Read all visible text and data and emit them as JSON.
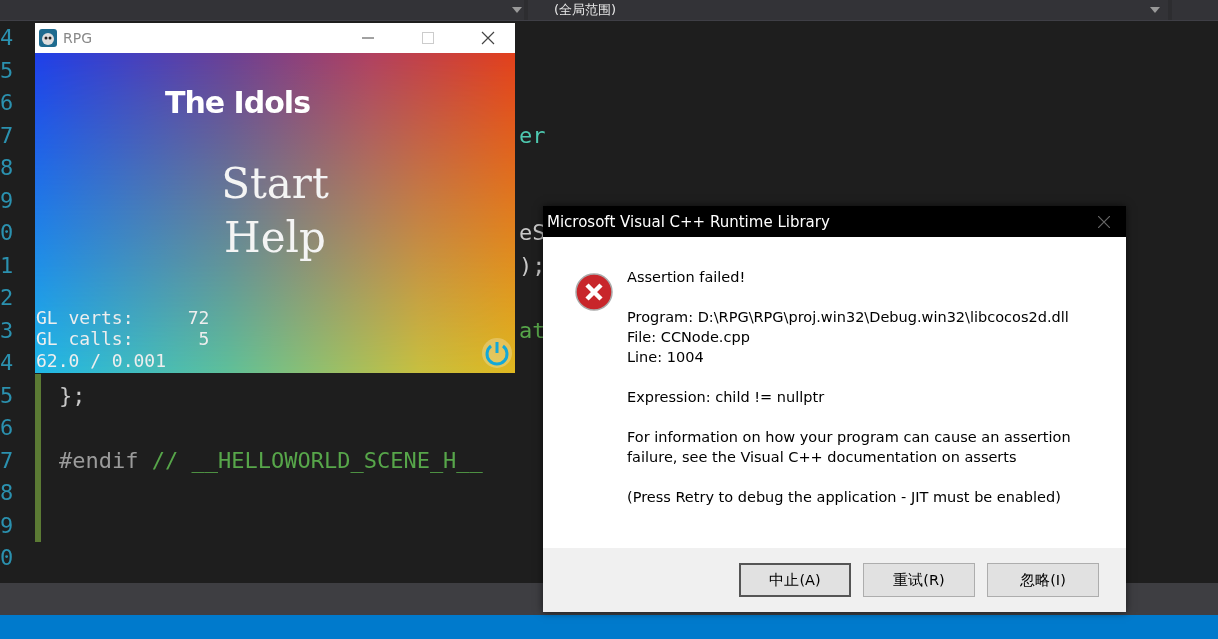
{
  "toolbar": {
    "scope_dropdown": "(全局范围)"
  },
  "editor": {
    "lines": [
      {
        "number": "4"
      },
      {
        "number": "5"
      },
      {
        "number": "6"
      },
      {
        "number": "7",
        "segments": [
          {
            "text": "er",
            "kind": "type"
          }
        ],
        "behind_window": true
      },
      {
        "number": "8"
      },
      {
        "number": "9"
      },
      {
        "number": "0",
        "segments": [
          {
            "text": "eS",
            "kind": "plain"
          }
        ],
        "behind_window": true
      },
      {
        "number": "1",
        "segments": [
          {
            "text": ");",
            "kind": "plain"
          }
        ],
        "behind_window": true
      },
      {
        "number": "2"
      },
      {
        "number": "3",
        "segments": [
          {
            "text": "at",
            "kind": "comment"
          }
        ],
        "behind_window": true
      },
      {
        "number": "4"
      },
      {
        "number": "5",
        "segments": [
          {
            "text": "};",
            "kind": "plain"
          }
        ]
      },
      {
        "number": "6"
      },
      {
        "number": "7",
        "segments": [
          {
            "text": "#endif",
            "kind": "directive"
          },
          {
            "text": " // __HELLOWORLD_SCENE_H__",
            "kind": "comment"
          }
        ]
      },
      {
        "number": "8"
      },
      {
        "number": "9"
      },
      {
        "number": "0"
      }
    ]
  },
  "game_window": {
    "title": "RPG",
    "logo": "The Idols",
    "menu": [
      {
        "label": "Start"
      },
      {
        "label": "Help"
      }
    ],
    "stats": [
      "GL verts:     72",
      "GL calls:      5",
      "62.0 / 0.001"
    ]
  },
  "dialog": {
    "title": "Microsoft Visual C++ Runtime Library",
    "heading": "Assertion failed!",
    "details": [
      "Program: D:\\RPG\\RPG\\proj.win32\\Debug.win32\\libcocos2d.dll",
      "File: CCNode.cpp",
      "Line: 1004"
    ],
    "expression": "Expression: child != nullptr",
    "info": "For information on how your program can cause an assertion failure, see the Visual C++ documentation on asserts",
    "hint": "(Press Retry to debug the application - JIT must be enabled)",
    "buttons": [
      {
        "label": "中止(A)",
        "selected": true
      },
      {
        "label": "重试(R)",
        "selected": false
      },
      {
        "label": "忽略(I)",
        "selected": false
      }
    ]
  }
}
